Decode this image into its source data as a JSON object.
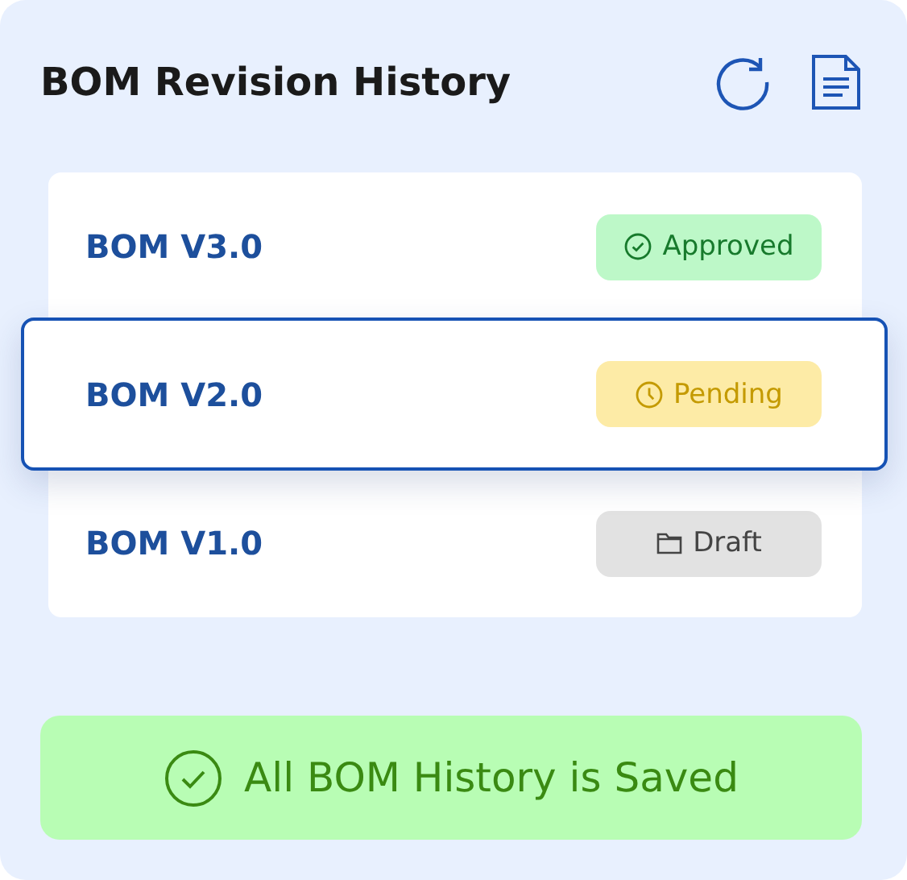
{
  "title": "BOM Revision History",
  "revisions": [
    {
      "name": "BOM V3.0",
      "status": "Approved",
      "kind": "approved",
      "selected": false
    },
    {
      "name": "BOM V2.0",
      "status": "Pending",
      "kind": "pending",
      "selected": true
    },
    {
      "name": "BOM V1.0",
      "status": "Draft",
      "kind": "draft",
      "selected": false
    }
  ],
  "footer": "All BOM History is Saved"
}
